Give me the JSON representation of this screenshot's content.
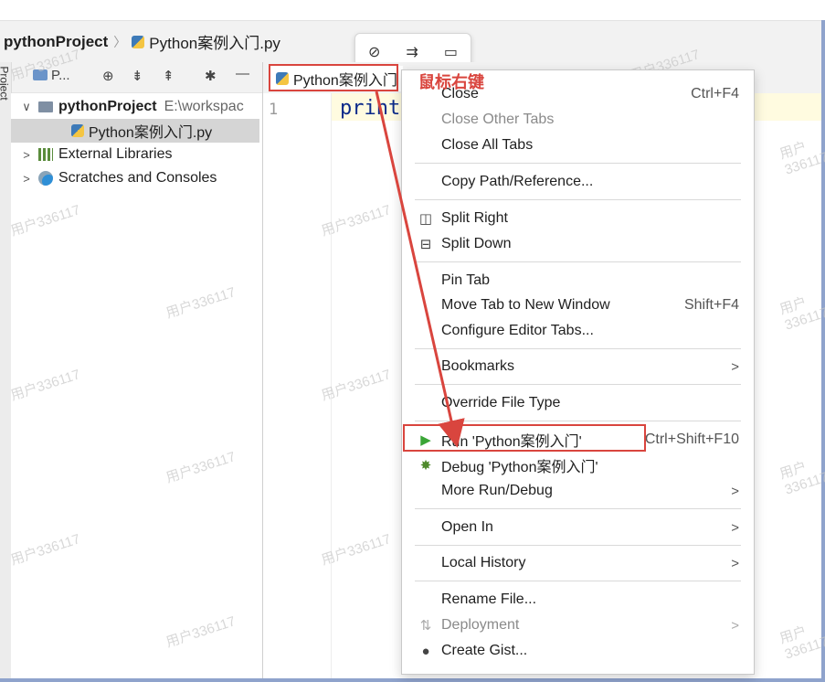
{
  "breadcrumb": {
    "project": "pythonProject",
    "file": "Python案例入门.py"
  },
  "floating_toolbar": {
    "icons": [
      "link-icon",
      "wrap-icon",
      "comment-icon"
    ]
  },
  "project_toolbar": {
    "view_label": "P..."
  },
  "side_stripe_label": "Project",
  "tree": {
    "root": {
      "name": "pythonProject",
      "path": "E:\\workspac"
    },
    "file": "Python案例入门.py",
    "external": "External Libraries",
    "scratches": "Scratches and Consoles"
  },
  "editor": {
    "tab_label": "Python案例入门",
    "line_number": "1",
    "code": "print"
  },
  "annotation": {
    "callout": "鼠标右键",
    "color": "#d9453e"
  },
  "watermark": "用户336117",
  "context_menu": {
    "close": {
      "label": "Close",
      "shortcut": "Ctrl+F4"
    },
    "close_other": "Close Other Tabs",
    "close_all": "Close All Tabs",
    "copy_path": "Copy Path/Reference...",
    "split_right": "Split Right",
    "split_down": "Split Down",
    "pin_tab": "Pin Tab",
    "move_tab": {
      "label": "Move Tab to New Window",
      "shortcut": "Shift+F4"
    },
    "configure_tabs": "Configure Editor Tabs...",
    "bookmarks": "Bookmarks",
    "override_type": "Override File Type",
    "run": {
      "label": "Run 'Python案例入门'",
      "shortcut": "Ctrl+Shift+F10"
    },
    "debug": "Debug 'Python案例入门'",
    "more_run": "More Run/Debug",
    "open_in": "Open In",
    "local_history": "Local History",
    "rename": "Rename File...",
    "deployment": "Deployment",
    "create_gist": "Create Gist..."
  }
}
